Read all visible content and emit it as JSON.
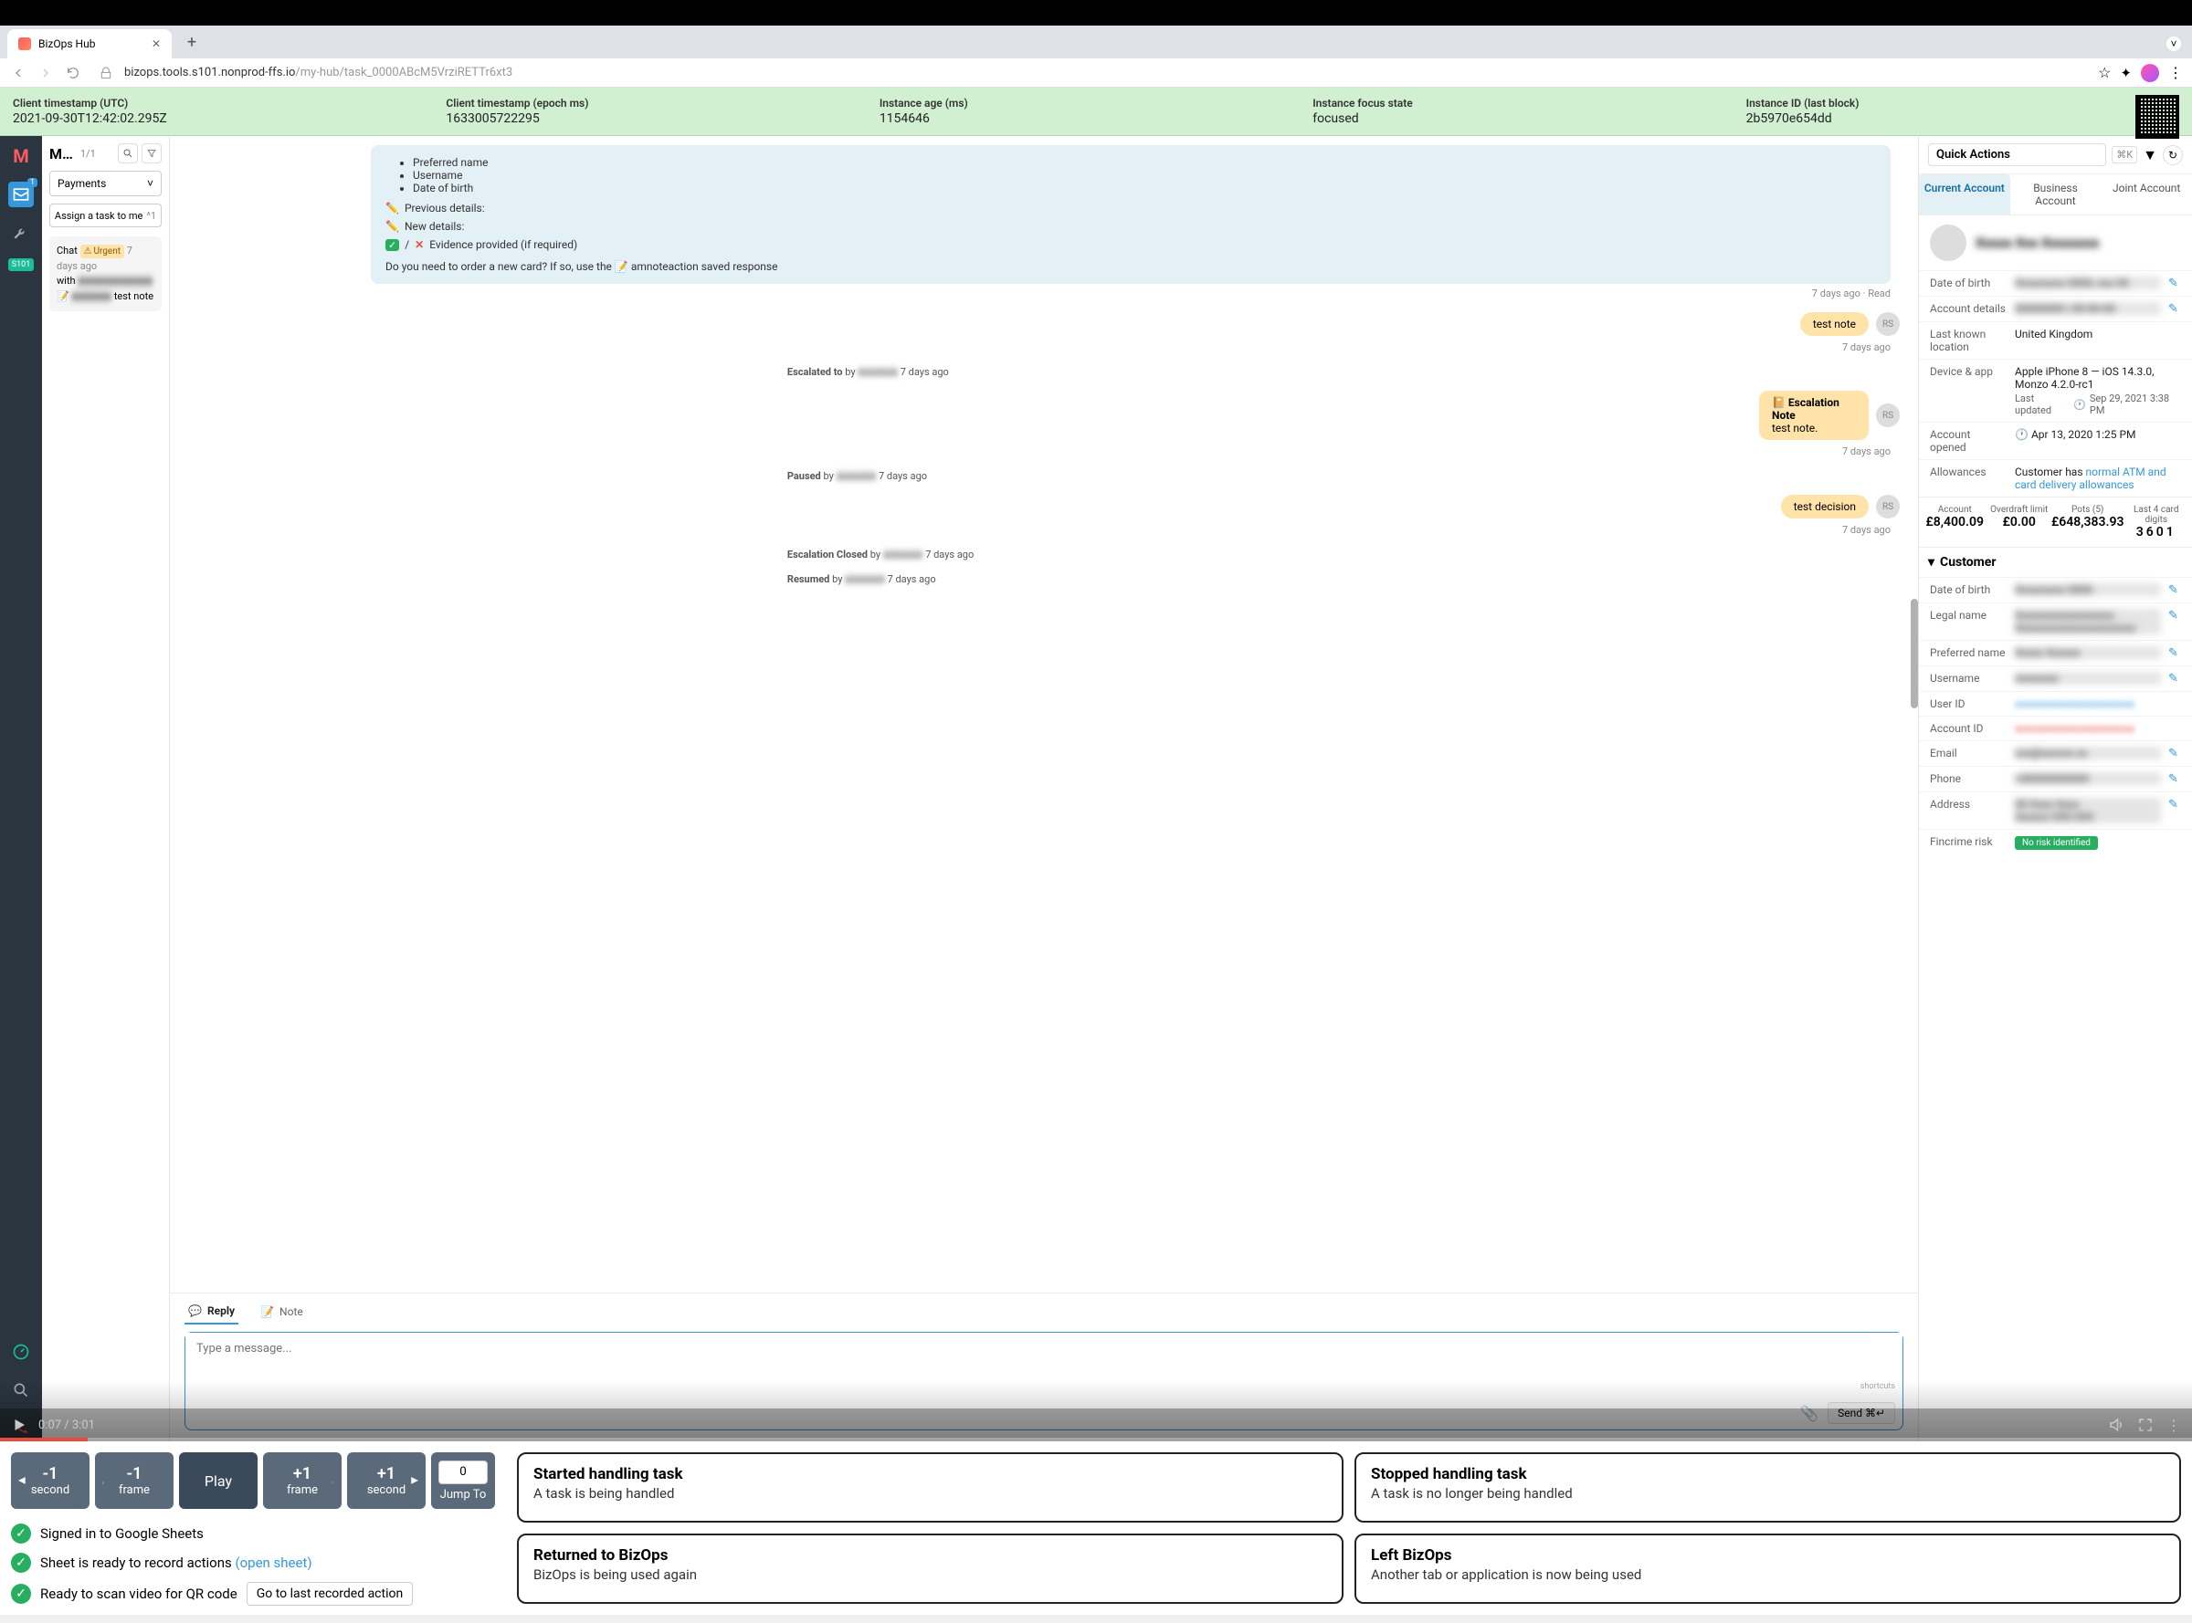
{
  "browser": {
    "tab_title": "BizOps Hub",
    "url_host": "bizops.tools.s101.nonprod-ffs.io",
    "url_path": "/my-hub/task_0000ABcM5VrziRETTr6xt3"
  },
  "info_strip": {
    "c1_label": "Client timestamp (UTC)",
    "c1_val": "2021-09-30T12:42:02.295Z",
    "c2_label": "Client timestamp (epoch ms)",
    "c2_val": "1633005722295",
    "c3_label": "Instance age (ms)",
    "c3_val": "1154646",
    "c4_label": "Instance focus state",
    "c4_val": "focused",
    "c5_label": "Instance ID (last block)",
    "c5_val": "2b5970e654dd"
  },
  "left_panel": {
    "title": "M…",
    "count": "1/1",
    "select": "Payments",
    "assign": "Assign a task to me",
    "assign_kbd": "^1",
    "chat": {
      "line1a": "Chat",
      "line1b": "with",
      "urgent": "Urgent",
      "time": "7 days ago",
      "note_label": "test note"
    }
  },
  "rail": {
    "tag": "S101"
  },
  "convo": {
    "info_bullets": [
      "Preferred name",
      "Username",
      "Date of birth"
    ],
    "line_prev": "Previous details:",
    "line_new": "New details:",
    "line_evid": "Evidence provided (if required)",
    "bottom": "Do you need to order a new card? If so, use the 📝 amnoteaction saved response",
    "meta1": "7 days ago · Read",
    "bubble1": "test note",
    "bubble1_time": "7 days ago",
    "sys_escalated": "Escalated to",
    "sys_by": "by",
    "sys_time": "7 days ago",
    "avatar_initials": "RS",
    "escalation_title": "📔 Escalation Note",
    "escalation_body": "test note.",
    "escalation_time": "7 days ago",
    "sys_paused": "Paused",
    "sys_paused_time": "7 days ago",
    "bubble3": "test decision",
    "bubble3_time": "7 days ago",
    "sys_closed": "Escalation Closed",
    "sys_closed_time": "7 days ago",
    "sys_resumed": "Resumed",
    "sys_resumed_time": "7 days ago"
  },
  "compose": {
    "tab_reply": "Reply",
    "tab_note": "Note",
    "placeholder": "Type a message...",
    "shortcuts": "shortcuts",
    "send": "Send ⌘↵"
  },
  "right": {
    "quick_actions": "Quick Actions",
    "qa_kbd": "⌘K",
    "tabs": {
      "current": "Current Account",
      "business": "Business Account",
      "joint": "Joint Account"
    },
    "fields": {
      "dob_label": "Date of birth",
      "acct_details_label": "Account details",
      "lastloc_label": "Last known location",
      "lastloc_val": "United Kingdom",
      "device_label": "Device & app",
      "device_val": "Apple iPhone 8 — iOS 14.3.0, Monzo 4.2.0-rc1",
      "device_sub_prefix": "Last updated",
      "device_sub": "Sep 29, 2021 3:38 PM",
      "opened_label": "Account opened",
      "opened_val": "Apr 13, 2020 1:25 PM",
      "allow_label": "Allowances",
      "allow_prefix": "Customer has ",
      "allow_link": "normal ATM and card delivery allowances"
    },
    "summary": {
      "acct_t": "Account",
      "acct_v": "£8,400.09",
      "od_t": "Overdraft limit",
      "od_v": "£0.00",
      "pots_t": "Pots (5)",
      "pots_v": "£648,383.93",
      "last4_t": "Last 4 card digits",
      "last4_v": "3601"
    },
    "customer_section": "Customer",
    "cust_fields": {
      "dob": "Date of birth",
      "legal": "Legal name",
      "pref": "Preferred name",
      "user": "Username",
      "uid": "User ID",
      "aid": "Account ID",
      "email": "Email",
      "phone": "Phone",
      "addr": "Address",
      "fincrime": "Fincrime risk"
    },
    "risk_pill": "No risk identified"
  },
  "video": {
    "time": "0:07 / 3:01"
  },
  "playback": {
    "minus_sec": "-1",
    "sec_label": "second",
    "minus_frame": "-1",
    "frame_label": "frame",
    "play": "Play",
    "plus_frame": "+1",
    "plus_sec": "+1",
    "jump_val": "0",
    "jump_label": "Jump To"
  },
  "status": {
    "s1": "Signed in to Google Sheets",
    "s2a": "Sheet is ready to record actions ",
    "s2b": "(open sheet)",
    "s3": "Ready to scan video for QR code",
    "s3_btn": "Go to last recorded action"
  },
  "events": {
    "e1_t": "Started handling task",
    "e1_d": "A task is being handled",
    "e2_t": "Stopped handling task",
    "e2_d": "A task is no longer being handled",
    "e3_t": "Returned to BizOps",
    "e3_d": "BizOps is being used again",
    "e4_t": "Left BizOps",
    "e4_d": "Another tab or application is now being used"
  }
}
